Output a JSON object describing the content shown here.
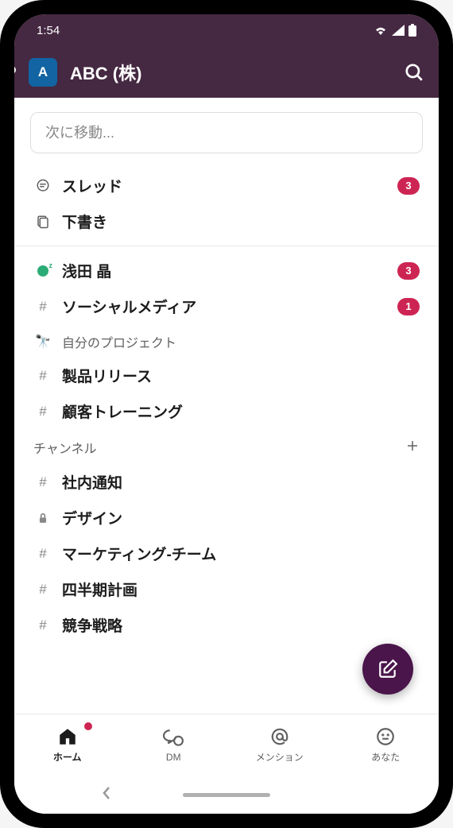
{
  "status": {
    "time": "1:54"
  },
  "header": {
    "workspace_letter": "A",
    "workspace_title": "ABC (株)"
  },
  "jump_to": {
    "placeholder": "次に移動..."
  },
  "top_items": [
    {
      "label": "スレッド",
      "badge": "3"
    },
    {
      "label": "下書き"
    }
  ],
  "unreads": {
    "user": {
      "name": "浅田 晶",
      "badge": "3"
    },
    "channel": {
      "name": "ソーシャルメディア",
      "badge": "1"
    }
  },
  "projects": {
    "header": "自分のプロジェクト",
    "emoji": "🔭",
    "items": [
      {
        "name": "製品リリース"
      },
      {
        "name": "顧客トレーニング"
      }
    ]
  },
  "channels": {
    "header": "チャンネル",
    "items": [
      {
        "name": "社内通知",
        "type": "hash"
      },
      {
        "name": "デザイン",
        "type": "lock"
      },
      {
        "name": "マーケティング-チーム",
        "type": "hash"
      },
      {
        "name": "四半期計画",
        "type": "hash"
      },
      {
        "name": "競争戦略",
        "type": "hash"
      }
    ]
  },
  "bottom_nav": {
    "home": "ホーム",
    "dm": "DM",
    "mentions": "メンション",
    "you": "あなた"
  }
}
